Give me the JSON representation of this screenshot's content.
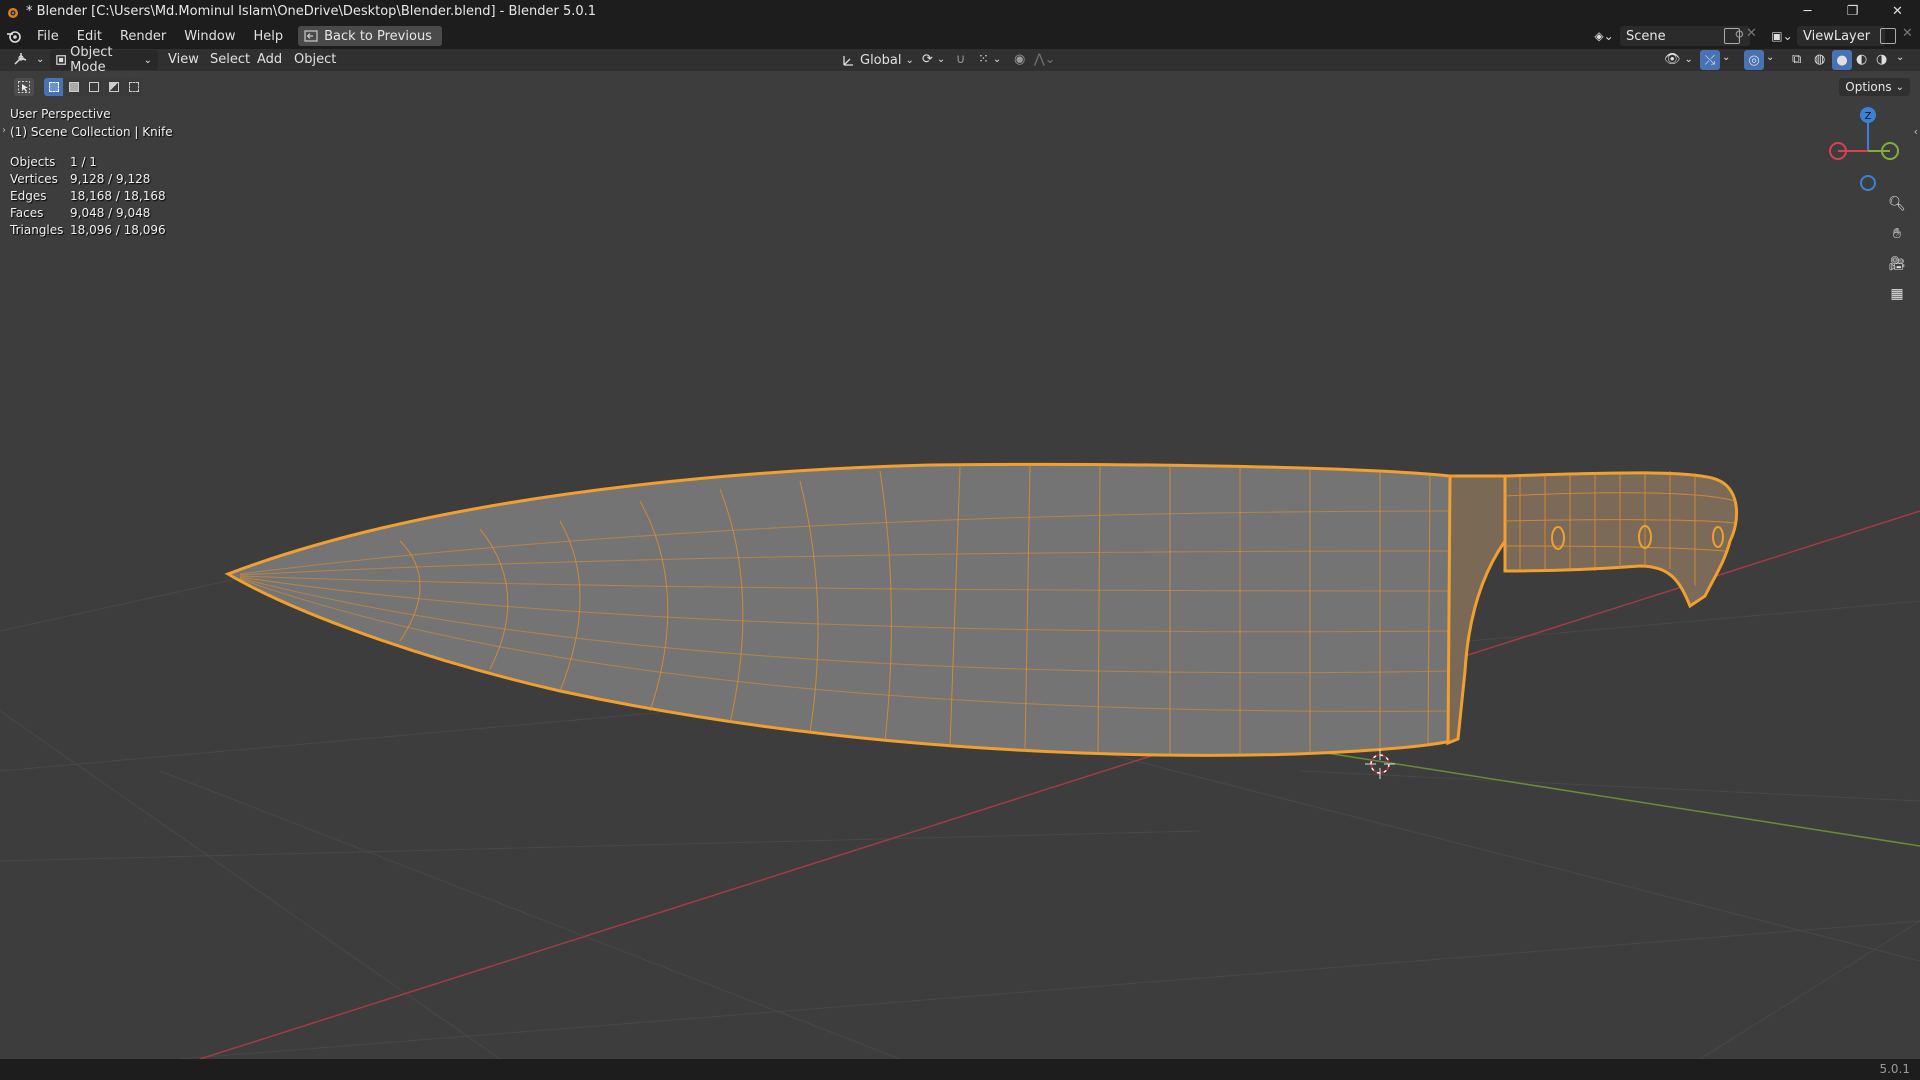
{
  "window": {
    "title": "* Blender [C:\\Users\\Md.Mominul Islam\\OneDrive\\Desktop\\Blender.blend] - Blender 5.0.1",
    "minimize": "─",
    "maximize": "❐",
    "close": "✕"
  },
  "menubar": {
    "items": [
      "File",
      "Edit",
      "Render",
      "Window",
      "Help"
    ],
    "back_button": "Back to Previous",
    "scene_label": "Scene",
    "view_layer_label": "ViewLayer"
  },
  "header": {
    "mode": "Object Mode",
    "menus": [
      "View",
      "Select",
      "Add",
      "Object"
    ],
    "transform_orientation": "Global"
  },
  "toolbar": {
    "options_label": "Options"
  },
  "viewport": {
    "perspective": "User Perspective",
    "collection": "(1) Scene Collection | Knife",
    "stats": [
      {
        "label": "Objects",
        "value": "1 / 1"
      },
      {
        "label": "Vertices",
        "value": "9,128 / 9,128"
      },
      {
        "label": "Edges",
        "value": "18,168 / 18,168"
      },
      {
        "label": "Faces",
        "value": "9,048 / 9,048"
      },
      {
        "label": "Triangles",
        "value": "18,096 / 18,096"
      }
    ],
    "gizmo_axis_z": "Z",
    "selection_color": "#f0a030",
    "background_color": "#3d3d3d"
  },
  "statusbar": {
    "version": "5.0.1"
  }
}
